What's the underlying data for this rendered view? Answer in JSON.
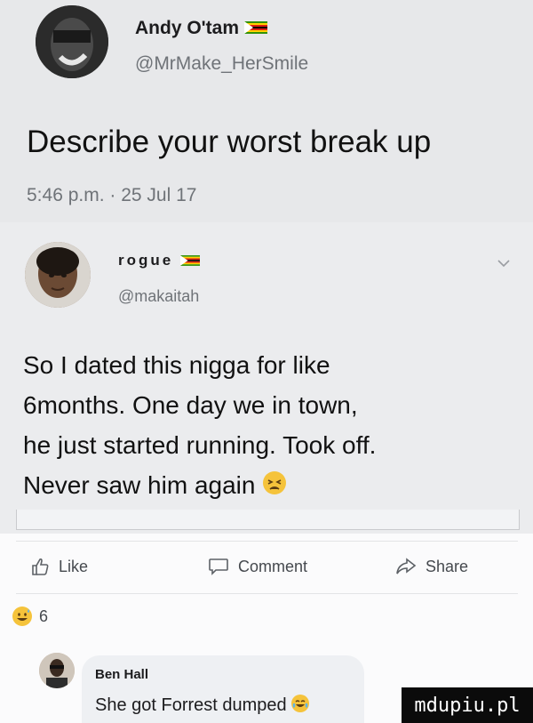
{
  "tweet": {
    "author_name": "Andy O'tam",
    "author_handle": "@MrMake_HerSmile",
    "text": "Describe your worst break up",
    "timestamp": "5:46 p.m. · 25 Jul 17",
    "flag_icon": "zimbabwe-flag-icon"
  },
  "quoted_tweet": {
    "author_name": "rogue",
    "author_handle": "@makaitah",
    "text_lines": [
      "So I dated this nigga for like",
      "6months. One day we in town,",
      "he just started running. Took off.",
      "Never saw him again"
    ],
    "trailing_emoji": "tired-face-emoji",
    "menu_icon": "chevron-down-icon"
  },
  "facebook": {
    "actions": {
      "like": "Like",
      "comment": "Comment",
      "share": "Share"
    },
    "reactions": {
      "emoji": "grinning-sweat-emoji",
      "count": "6"
    },
    "comment": {
      "author": "Ben Hall",
      "text": "She got Forrest dumped",
      "emoji": "tears-of-joy-emoji"
    }
  },
  "watermark": "mdupiu.pl",
  "colors": {
    "tweet_background": "#e7e8ea",
    "feed_background": "#fbfbfc",
    "bubble_background": "#eef0f3",
    "muted_text": "#6f7378",
    "emoji_yellow": "#f5c33b"
  }
}
